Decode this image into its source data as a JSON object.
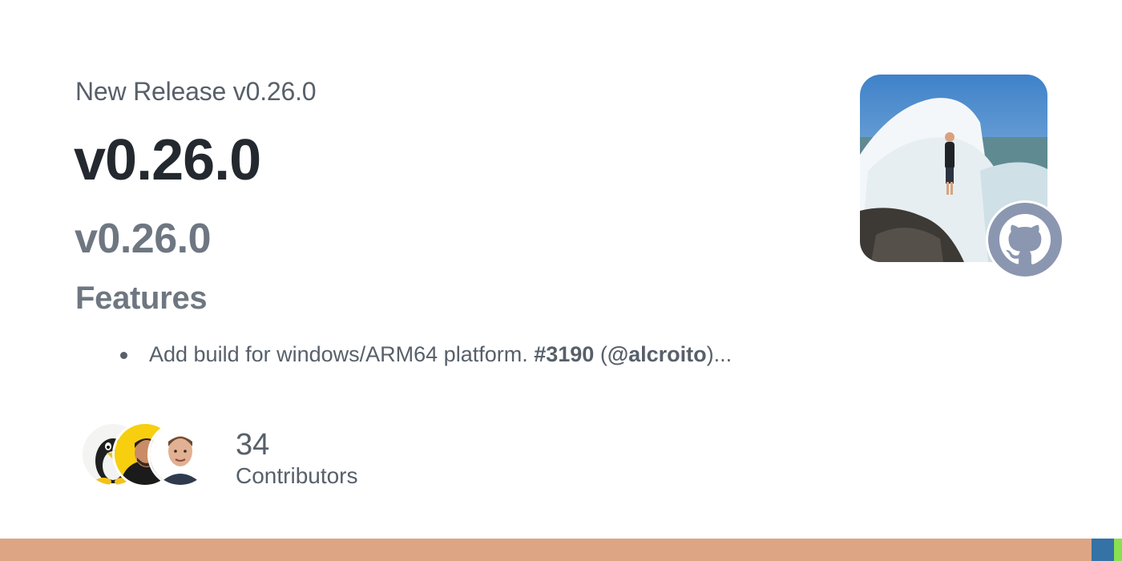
{
  "header": {
    "subtitle": "New Release v0.26.0",
    "title": "v0.26.0"
  },
  "body": {
    "release_heading": "v0.26.0",
    "section_heading": "Features",
    "features": [
      {
        "text_before": "Add build for windows/ARM64 platform. ",
        "pr": "#3190",
        "paren_open": " (",
        "author": "@alcroito",
        "paren_close": ")..."
      }
    ]
  },
  "contributors": {
    "count": "34",
    "label": "Contributors"
  },
  "icons": {
    "owner_avatar": "owner-avatar-photo",
    "github": "github-mark-icon"
  },
  "colors": {
    "language_bar": [
      "#dea584",
      "#3572a5",
      "#89e051"
    ],
    "github_badge": "#8b97b0"
  },
  "language_bar": [
    0.973,
    0.02,
    0.007
  ]
}
